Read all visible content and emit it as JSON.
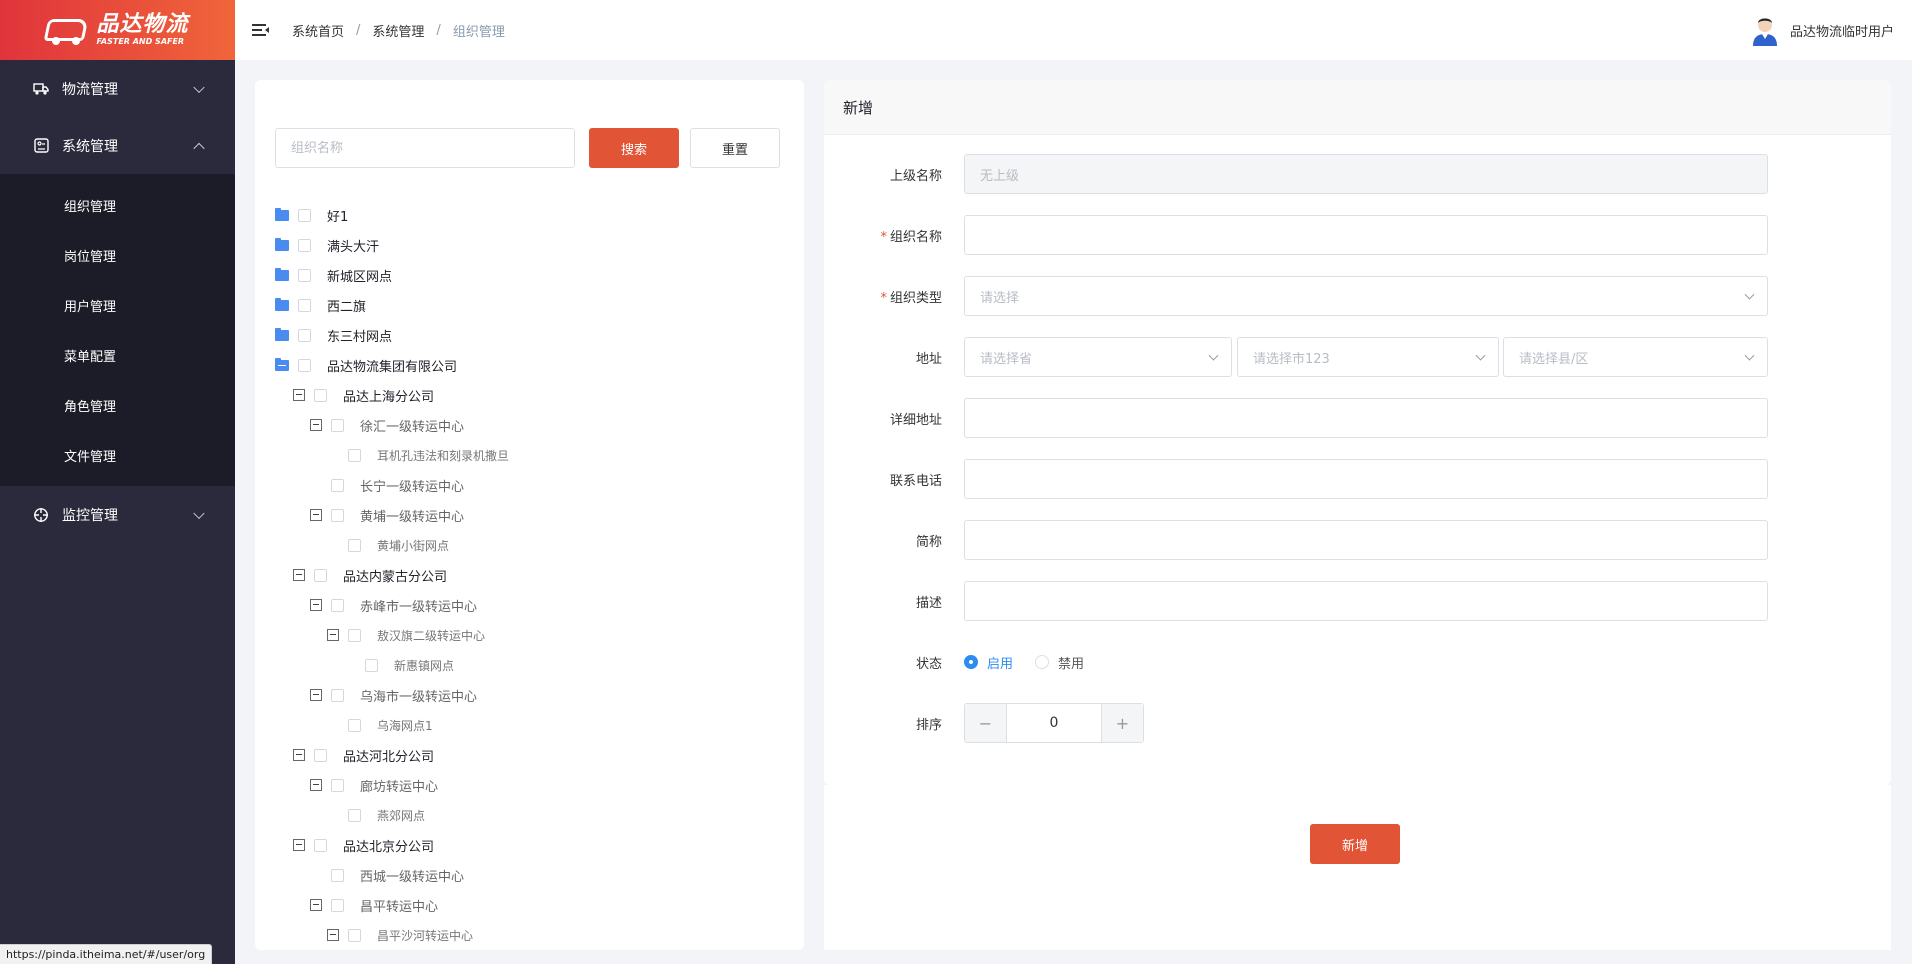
{
  "logo": {
    "name": "品达物流",
    "slogan": "FASTER AND SAFER"
  },
  "sidebar": {
    "groups": [
      {
        "label": "物流管理",
        "icon": "truck-icon",
        "expanded": false
      },
      {
        "label": "系统管理",
        "icon": "settings-panel-icon",
        "expanded": true
      },
      {
        "label": "监控管理",
        "icon": "crosshair-icon",
        "expanded": false
      }
    ],
    "sub_items": [
      "组织管理",
      "岗位管理",
      "用户管理",
      "菜单配置",
      "角色管理",
      "文件管理"
    ]
  },
  "header": {
    "breadcrumbs": [
      "系统首页",
      "系统管理",
      "组织管理"
    ],
    "separator": "/",
    "user_name": "品达物流临时用户"
  },
  "search": {
    "placeholder": "组织名称",
    "value": "",
    "search_label": "搜索",
    "reset_label": "重置"
  },
  "tree": [
    {
      "label": "好1",
      "level": 0,
      "folder": "closed"
    },
    {
      "label": "满头大汗",
      "level": 0,
      "folder": "closed"
    },
    {
      "label": "新城区网点",
      "level": 0,
      "folder": "closed"
    },
    {
      "label": "西二旗",
      "level": 0,
      "folder": "closed"
    },
    {
      "label": "东三村网点",
      "level": 0,
      "folder": "closed"
    },
    {
      "label": "品达物流集团有限公司",
      "level": 0,
      "folder": "open"
    },
    {
      "label": "品达上海分公司",
      "level": 1,
      "toggle": true
    },
    {
      "label": "徐汇一级转运中心",
      "level": 2,
      "toggle": true
    },
    {
      "label": "耳机孔违法和刻录机撒旦",
      "level": 3,
      "toggle": false
    },
    {
      "label": "长宁一级转运中心",
      "level": 2,
      "toggle": false
    },
    {
      "label": "黄埔一级转运中心",
      "level": 2,
      "toggle": true
    },
    {
      "label": "黄埔小街网点",
      "level": 3,
      "toggle": false
    },
    {
      "label": "品达内蒙古分公司",
      "level": 1,
      "toggle": true
    },
    {
      "label": "赤峰市一级转运中心",
      "level": 2,
      "toggle": true
    },
    {
      "label": "敖汉旗二级转运中心",
      "level": 3,
      "toggle": true
    },
    {
      "label": "新惠镇网点",
      "level": 4,
      "toggle": false
    },
    {
      "label": "乌海市一级转运中心",
      "level": 2,
      "toggle": true
    },
    {
      "label": "乌海网点1",
      "level": 3,
      "toggle": false
    },
    {
      "label": "品达河北分公司",
      "level": 1,
      "toggle": true
    },
    {
      "label": "廊坊转运中心",
      "level": 2,
      "toggle": true
    },
    {
      "label": "燕郊网点",
      "level": 3,
      "toggle": false
    },
    {
      "label": "品达北京分公司",
      "level": 1,
      "toggle": true
    },
    {
      "label": "西城一级转运中心",
      "level": 2,
      "toggle": false
    },
    {
      "label": "昌平转运中心",
      "level": 2,
      "toggle": true
    },
    {
      "label": "昌平沙河转运中心",
      "level": 3,
      "toggle": true
    }
  ],
  "form": {
    "title": "新增",
    "parent": {
      "label": "上级名称",
      "placeholder": "无上级"
    },
    "org_name": {
      "label": "组织名称",
      "value": ""
    },
    "org_type": {
      "label": "组织类型",
      "placeholder": "请选择"
    },
    "address": {
      "label": "地址",
      "province": "请选择省",
      "city": "请选择市123",
      "district": "请选择县/区"
    },
    "detail_address": {
      "label": "详细地址",
      "value": ""
    },
    "phone": {
      "label": "联系电话",
      "value": ""
    },
    "abbr": {
      "label": "简称",
      "value": ""
    },
    "desc": {
      "label": "描述",
      "value": ""
    },
    "status": {
      "label": "状态",
      "options": [
        "启用",
        "禁用"
      ],
      "selected": "启用"
    },
    "sort": {
      "label": "排序",
      "value": "0",
      "minus": "−",
      "plus": "+"
    },
    "submit_label": "新增"
  },
  "status_bar": {
    "url": "https://pinda.itheima.net/#/user/org"
  },
  "colors": {
    "accent": "#e15536",
    "sidebar": "#2a2a3c",
    "submenu": "#1c1c28",
    "link": "#2d8cf0",
    "folder": "#4a8bf0"
  }
}
